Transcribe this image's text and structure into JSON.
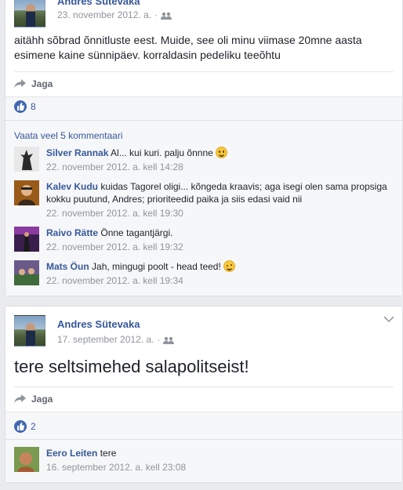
{
  "post1": {
    "author": "Andres Sütevaka",
    "date": "23. november 2012. a.",
    "dot": "·",
    "text": "aitähh sõbrad õnnitluste eest. Muide, see oli minu viimase 20mne aasta esimene kaine sünnipäev. korraldasin pedeliku teeõhtu",
    "share_label": "Jaga",
    "like_count": "8",
    "view_more": "Vaata veel 5 kommentaari",
    "comments": [
      {
        "name": "Silver Rannak",
        "text": "Al... kui kuri. palju õnnne",
        "time": "22. november 2012. a. kell 14:28",
        "emoji": "smile"
      },
      {
        "name": "Kalev Kudu",
        "text": "kuidas Tagorel oligi... kõngeda kraavis; aga isegi olen sama propsiga kokku puutund, Andres; prioriteedid paika ja siis edasi vaid nii",
        "time": "22. november 2012. a. kell 19:30"
      },
      {
        "name": "Raivo Rätte",
        "text": "Önne tagantjärgi.",
        "time": "22. november 2012. a. kell 19:32"
      },
      {
        "name": "Mats Öun",
        "text": "Jah, mingugi poolt - head teed!",
        "time": "22. november 2012. a. kell 19:34",
        "emoji": "wink"
      }
    ]
  },
  "post2": {
    "author": "Andres Sütevaka",
    "date": "17. september 2012. a.",
    "dot": "·",
    "text": "tere seltsimehed salapolitseist!",
    "share_label": "Jaga",
    "like_count": "2",
    "comments": [
      {
        "name": "Eero Leiten",
        "text": "tere",
        "time": "16. september 2012. a. kell 23:08"
      }
    ]
  },
  "colors": {
    "link": "#365899",
    "meta": "#90949c",
    "like": "#4267b2",
    "background": "#e9ebee"
  },
  "icons": [
    "audience-friends-icon",
    "share-arrow-icon",
    "like-thumb-icon",
    "chevron-down-icon",
    "smile-emoji-icon",
    "wink-emoji-icon"
  ]
}
